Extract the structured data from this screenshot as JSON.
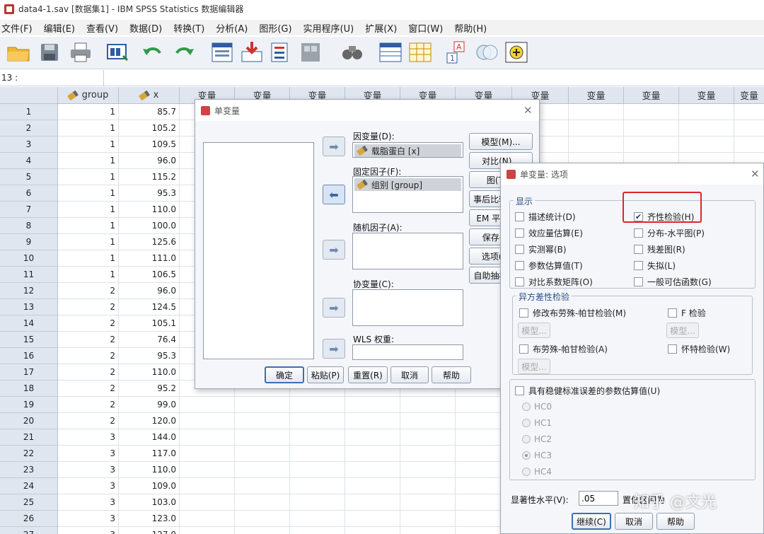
{
  "window": {
    "title": "data4-1.sav [数据集1] - IBM SPSS Statistics 数据编辑器"
  },
  "menu": [
    "文件(F)",
    "编辑(E)",
    "查看(V)",
    "数据(D)",
    "转换(T)",
    "分析(A)",
    "图形(G)",
    "实用程序(U)",
    "扩展(X)",
    "窗口(W)",
    "帮助(H)"
  ],
  "cell_ref": "13 :",
  "grid": {
    "col_group": "group",
    "col_x": "x",
    "empty_col": "变量",
    "rows": [
      [
        "1",
        "1",
        "85.7"
      ],
      [
        "2",
        "1",
        "105.2"
      ],
      [
        "3",
        "1",
        "109.5"
      ],
      [
        "4",
        "1",
        "96.0"
      ],
      [
        "5",
        "1",
        "115.2"
      ],
      [
        "6",
        "1",
        "95.3"
      ],
      [
        "7",
        "1",
        "110.0"
      ],
      [
        "8",
        "1",
        "100.0"
      ],
      [
        "9",
        "1",
        "125.6"
      ],
      [
        "10",
        "1",
        "111.0"
      ],
      [
        "11",
        "1",
        "106.5"
      ],
      [
        "12",
        "2",
        "96.0"
      ],
      [
        "13",
        "2",
        "124.5"
      ],
      [
        "14",
        "2",
        "105.1"
      ],
      [
        "15",
        "2",
        "76.4"
      ],
      [
        "16",
        "2",
        "95.3"
      ],
      [
        "17",
        "2",
        "110.0"
      ],
      [
        "18",
        "2",
        "95.2"
      ],
      [
        "19",
        "2",
        "99.0"
      ],
      [
        "20",
        "2",
        "120.0"
      ],
      [
        "21",
        "3",
        "144.0"
      ],
      [
        "22",
        "3",
        "117.0"
      ],
      [
        "23",
        "3",
        "110.0"
      ],
      [
        "24",
        "3",
        "109.0"
      ],
      [
        "25",
        "3",
        "103.0"
      ],
      [
        "26",
        "3",
        "123.0"
      ],
      [
        "27",
        "3",
        "127.0"
      ]
    ]
  },
  "univariate": {
    "title": "单变量",
    "dependent_label": "因变量(D):",
    "dependent_value": "载脂蛋白 [x]",
    "fixed_label": "固定因子(F):",
    "fixed_value": "组别 [group]",
    "random_label": "随机因子(A):",
    "covariate_label": "协变量(C):",
    "wls_label": "WLS 权重:",
    "side_buttons": [
      "模型(M)...",
      "对比(N)...",
      "图(T)...",
      "事后比较(H)...",
      "EM 平均值...",
      "保存(S)...",
      "选项(O)...",
      "自助抽样(B)..."
    ],
    "bottom_buttons": [
      "确定",
      "粘贴(P)",
      "重置(R)",
      "取消",
      "帮助"
    ]
  },
  "options": {
    "title": "单变量: 选项",
    "display_group": "显示",
    "checks_left": [
      "描述统计(D)",
      "效应量估算(E)",
      "实测幂(B)",
      "参数估算值(T)",
      "对比系数矩阵(O)"
    ],
    "checks_right": [
      "齐性检验(H)",
      "分布-水平图(P)",
      "残差图(R)",
      "失拟(L)",
      "一般可估函数(G)"
    ],
    "homogeneity_checked": true,
    "hetero_group": "异方差性检验",
    "hetero_items": [
      "修改布劳殊-帕甘检验(M)",
      "F 检验",
      "布劳殊-帕甘检验(A)",
      "怀特检验(W)"
    ],
    "model_btn": "模型...",
    "robust_label": "具有稳健标准误差的参数估算值(U)",
    "hc_options": [
      "HC0",
      "HC1",
      "HC2",
      "HC3",
      "HC4"
    ],
    "hc_selected": "HC3",
    "sig_label": "显著性水平(V):",
    "sig_value": ".05",
    "ci_label": "置信区间为",
    "buttons": [
      "继续(C)",
      "取消",
      "帮助"
    ]
  },
  "watermark": "知乎 @文光",
  "highlight_color": "#e0242b"
}
